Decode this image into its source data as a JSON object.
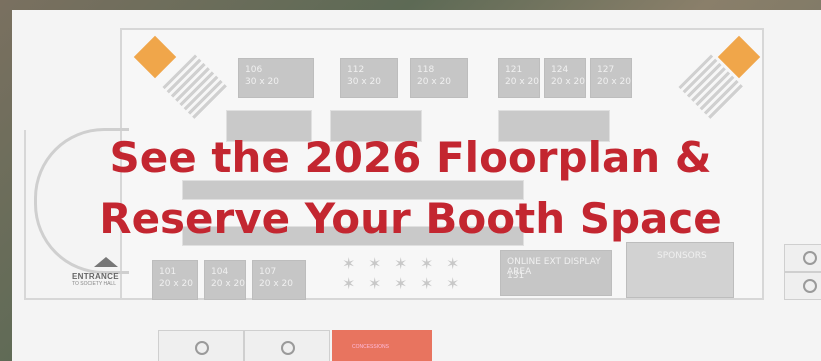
{
  "headline": {
    "line1": "See the 2026 Floorplan &",
    "line2": "Reserve Your Booth Space"
  },
  "map": {
    "entrance_label": "ENTRANCE",
    "entrance_sub": "TO SOCIETY HALL",
    "display_area_label": "ONLINE EXT DISPLAY AREA",
    "lounge_label": "SPONSORS",
    "concession_label": "CONCESSIONS",
    "booths": [
      {
        "id": "106",
        "size": "30 x 20"
      },
      {
        "id": "112",
        "size": "30 x 20"
      },
      {
        "id": "118",
        "size": "20 x 20"
      },
      {
        "id": "121",
        "size": "20 x 20"
      },
      {
        "id": "124",
        "size": "20 x 20"
      },
      {
        "id": "127",
        "size": "20 x 20"
      },
      {
        "id": "101",
        "size": "20 x 20"
      },
      {
        "id": "104",
        "size": "20 x 20"
      },
      {
        "id": "107",
        "size": "20 x 20"
      },
      {
        "id": "131",
        "size": "20 x 20"
      }
    ]
  },
  "colors": {
    "headline": "#c32630",
    "accent_orange": "#f0a64a",
    "concession_red": "#e8745f"
  }
}
